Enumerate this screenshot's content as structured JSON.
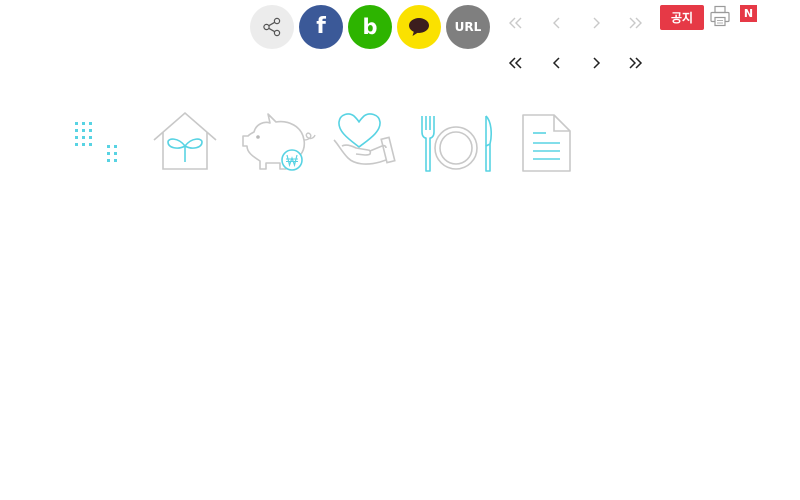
{
  "share": {
    "share_icon": "share-icon",
    "facebook_label": "f",
    "band_label": "b",
    "kakao_icon": "speech-bubble-icon",
    "url_label": "URL"
  },
  "pagination_top": [
    "first-page-icon",
    "prev-page-icon",
    "next-page-icon",
    "last-page-icon"
  ],
  "pagination_bottom": [
    "first-page-icon",
    "prev-page-icon",
    "next-page-icon",
    "last-page-icon"
  ],
  "notice": {
    "label": "공지",
    "print_icon": "printer-icon",
    "new_label": "N"
  },
  "categories": [
    "dots-grid-icon",
    "house-sprout-icon",
    "piggy-bank-won-icon",
    "hand-heart-icon",
    "fork-plate-knife-icon",
    "document-icon"
  ],
  "colors": {
    "share_bg": "#ececec",
    "facebook": "#3b5998",
    "band": "#2db400",
    "kakao": "#fae100",
    "url": "#7f7f7f",
    "notice_red": "#e63946",
    "accent_cyan": "#58d3e3",
    "icon_gray": "#c8c8c8",
    "pager_light": "#c9c9c9",
    "pager_dark": "#222222"
  }
}
